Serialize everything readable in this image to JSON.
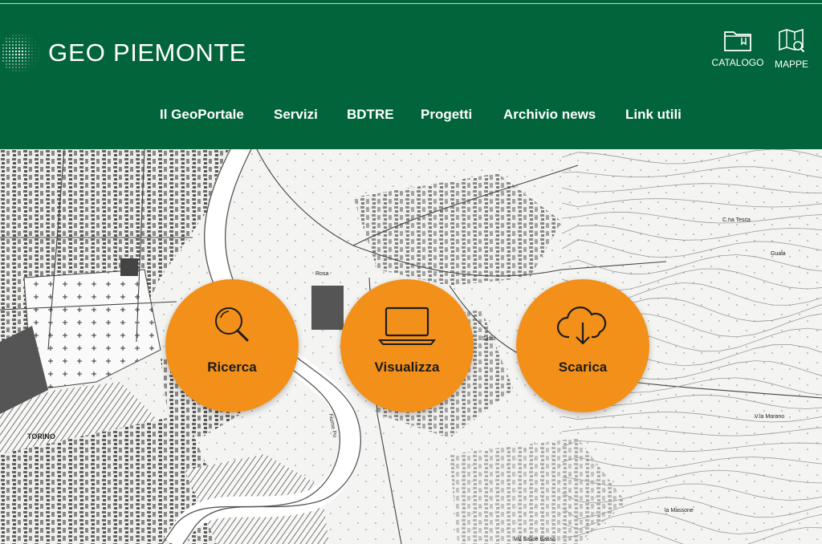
{
  "header": {
    "brand_left": "GEO",
    "brand_right": "PIEMONTE",
    "bg_color": "#02643a",
    "actions": [
      {
        "label": "CATALOGO",
        "icon": "folder-icon"
      },
      {
        "label": "MAPPE",
        "icon": "map-search-icon"
      }
    ]
  },
  "nav": {
    "items": [
      {
        "label": "Il GeoPortale"
      },
      {
        "label": "Servizi"
      },
      {
        "label": "BDTRE"
      },
      {
        "label": "Progetti"
      },
      {
        "label": "Archivio news"
      },
      {
        "label": "Link utili"
      }
    ]
  },
  "map": {
    "labels": {
      "torino": "TORINO",
      "rosa": "Rosa",
      "sassi": "Sassi",
      "villa_morano": "V.la Morano",
      "massone": "la Massone",
      "guala": "Guala",
      "tesca": "C.na Tesca",
      "basso": "Val Salice Basso",
      "fiume": "Fiume Po"
    }
  },
  "actions": [
    {
      "label": "Ricerca",
      "icon": "search-icon"
    },
    {
      "label": "Visualizza",
      "icon": "laptop-icon"
    },
    {
      "label": "Scarica",
      "icon": "cloud-download-icon"
    }
  ],
  "accent_color": "#f39019"
}
